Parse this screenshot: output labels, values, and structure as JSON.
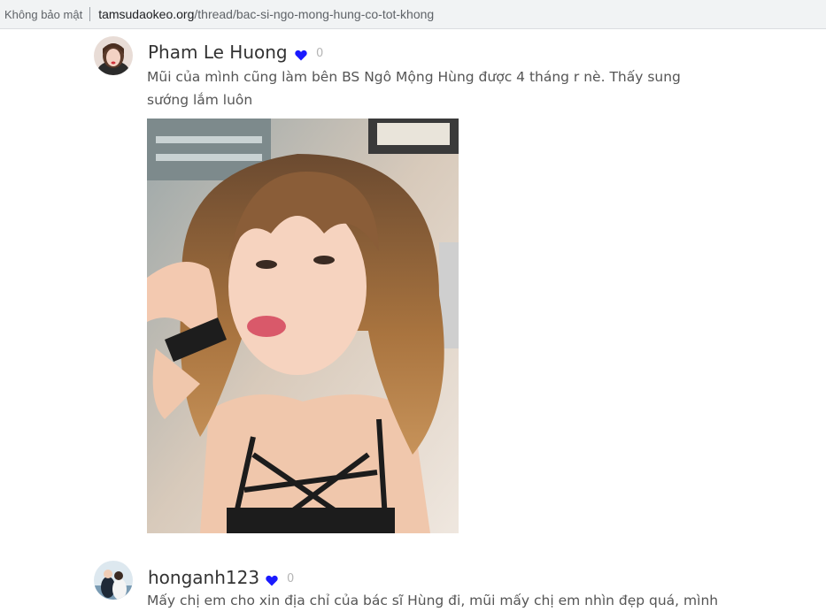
{
  "browser": {
    "security_label": "Không bảo mật",
    "url_domain": "tamsudaokeo.org",
    "url_path": "/thread/bac-si-ngo-mong-hung-co-tot-khong"
  },
  "posts": [
    {
      "username": "Pham Le Huong",
      "likes": "0",
      "text": "Mũi của mình cũng làm bên BS Ngô Mộng Hùng được 4 tháng r nè. Thấy sung sướng lắm luôn",
      "has_photo": true
    },
    {
      "username": "honganh123",
      "likes": "0",
      "text": "Mấy chị em cho xin địa chỉ của bác sĩ Hùng đi, mũi mấy chị em nhìn đẹp quá, mình"
    }
  ],
  "colors": {
    "heart": "#1a1aff",
    "username": "#333333",
    "body_text": "#555555",
    "likes": "#b5b5b5"
  }
}
